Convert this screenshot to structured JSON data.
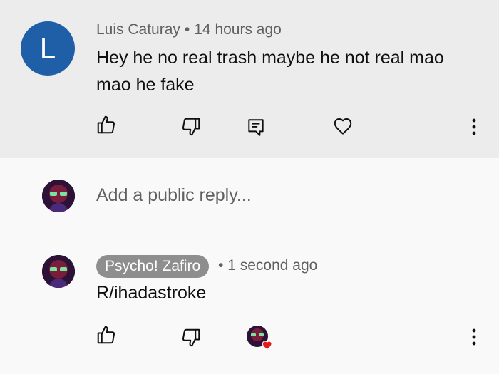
{
  "comment": {
    "avatar_letter": "L",
    "author": "Luis Caturay",
    "separator": "•",
    "time": "14 hours ago",
    "text": "Hey he no real trash maybe he not real  mao mao he fake",
    "actions": [
      "like-icon",
      "dislike-icon",
      "reply-icon",
      "heart-icon",
      "more-vert-icon"
    ],
    "avatar_color": "#1f5fa8"
  },
  "reply_box": {
    "placeholder": "Add a public reply..."
  },
  "reply": {
    "author": "Psycho! Zafiro",
    "separator": "•",
    "time": "1 second ago",
    "text": "R/ihadastroke",
    "actions": [
      "like-icon",
      "dislike-icon",
      "creator-heart-icon",
      "more-vert-icon"
    ],
    "heart_color": "#e21b1b"
  }
}
